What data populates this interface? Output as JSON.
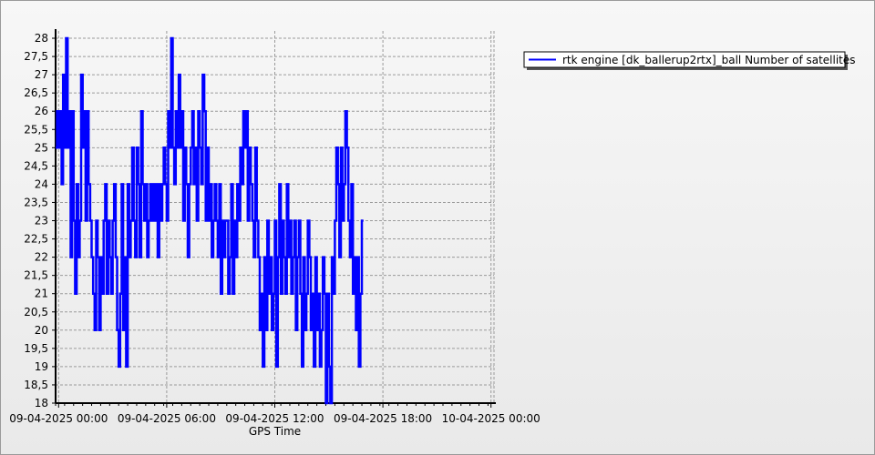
{
  "chart_data": {
    "type": "line",
    "xlabel": "GPS Time",
    "ylabel": "",
    "x_ticks": [
      "09-04-2025 00:00",
      "09-04-2025 06:00",
      "09-04-2025 12:00",
      "09-04-2025 18:00",
      "10-04-2025 00:00"
    ],
    "y_ticks": [
      "18",
      "18,5",
      "19",
      "19,5",
      "20",
      "20,5",
      "21",
      "21,5",
      "22",
      "22,5",
      "23",
      "23,5",
      "24",
      "24,5",
      "25",
      "25,5",
      "26",
      "26,5",
      "27",
      "27,5",
      "28"
    ],
    "xlim": [
      "2025-04-08T23:50",
      "2025-04-10T00:10"
    ],
    "ylim": [
      18,
      28.2
    ],
    "grid": true,
    "legend_position": "top-right",
    "series": [
      {
        "name": "rtk engine [dk_ballerup2rtx]_ball Number of satellites",
        "color": "#0000ff",
        "time_start": "2025-04-08T23:50",
        "step_minutes": 5,
        "values": [
          25,
          26,
          25,
          26,
          24,
          27,
          25,
          28,
          25,
          26,
          22,
          26,
          23,
          21,
          24,
          22,
          23,
          27,
          25,
          26,
          23,
          26,
          24,
          23,
          22,
          21,
          20,
          23,
          22,
          20,
          22,
          21,
          23,
          24,
          21,
          23,
          22,
          21,
          23,
          24,
          22,
          20,
          19,
          21,
          24,
          20,
          22,
          19,
          24,
          22,
          23,
          25,
          23,
          22,
          25,
          24,
          22,
          26,
          24,
          23,
          24,
          22,
          23,
          24,
          23,
          24,
          23,
          24,
          22,
          24,
          23,
          24,
          25,
          24,
          23,
          26,
          25,
          28,
          25,
          24,
          26,
          25,
          27,
          25,
          26,
          23,
          25,
          24,
          22,
          24,
          25,
          26,
          24,
          25,
          23,
          26,
          25,
          24,
          27,
          26,
          23,
          25,
          23,
          24,
          22,
          23,
          24,
          23,
          22,
          24,
          21,
          23,
          22,
          23,
          23,
          21,
          22,
          24,
          21,
          23,
          22,
          24,
          23,
          25,
          24,
          26,
          25,
          26,
          23,
          25,
          24,
          23,
          22,
          25,
          23,
          22,
          20,
          21,
          19,
          22,
          20,
          23,
          21,
          22,
          20,
          21,
          23,
          19,
          22,
          24,
          21,
          23,
          22,
          21,
          24,
          22,
          23,
          21,
          22,
          23,
          20,
          22,
          23,
          21,
          19,
          22,
          20,
          21,
          23,
          22,
          20,
          21,
          19,
          22,
          20,
          21,
          19,
          20,
          22,
          21,
          18,
          21,
          19,
          18,
          22,
          21,
          23,
          25,
          24,
          22,
          25,
          23,
          24,
          26,
          25,
          23,
          22,
          24,
          21,
          22,
          20,
          22,
          19,
          21,
          23
        ]
      }
    ]
  }
}
